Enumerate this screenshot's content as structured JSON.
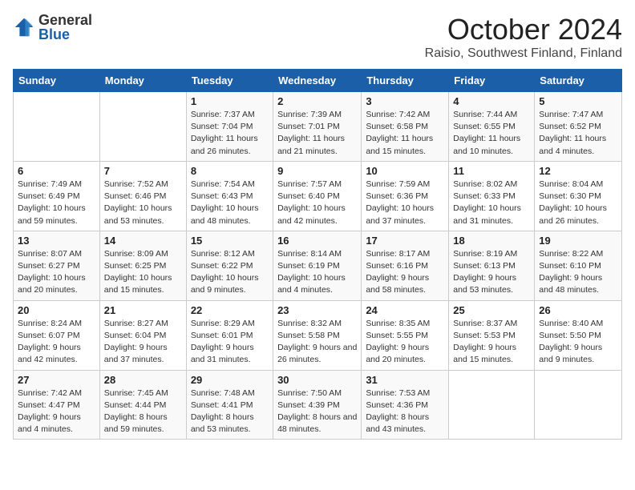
{
  "logo": {
    "general": "General",
    "blue": "Blue"
  },
  "header": {
    "month": "October 2024",
    "location": "Raisio, Southwest Finland, Finland"
  },
  "weekdays": [
    "Sunday",
    "Monday",
    "Tuesday",
    "Wednesday",
    "Thursday",
    "Friday",
    "Saturday"
  ],
  "weeks": [
    [
      {
        "day": "",
        "info": ""
      },
      {
        "day": "",
        "info": ""
      },
      {
        "day": "1",
        "info": "Sunrise: 7:37 AM\nSunset: 7:04 PM\nDaylight: 11 hours and 26 minutes."
      },
      {
        "day": "2",
        "info": "Sunrise: 7:39 AM\nSunset: 7:01 PM\nDaylight: 11 hours and 21 minutes."
      },
      {
        "day": "3",
        "info": "Sunrise: 7:42 AM\nSunset: 6:58 PM\nDaylight: 11 hours and 15 minutes."
      },
      {
        "day": "4",
        "info": "Sunrise: 7:44 AM\nSunset: 6:55 PM\nDaylight: 11 hours and 10 minutes."
      },
      {
        "day": "5",
        "info": "Sunrise: 7:47 AM\nSunset: 6:52 PM\nDaylight: 11 hours and 4 minutes."
      }
    ],
    [
      {
        "day": "6",
        "info": "Sunrise: 7:49 AM\nSunset: 6:49 PM\nDaylight: 10 hours and 59 minutes."
      },
      {
        "day": "7",
        "info": "Sunrise: 7:52 AM\nSunset: 6:46 PM\nDaylight: 10 hours and 53 minutes."
      },
      {
        "day": "8",
        "info": "Sunrise: 7:54 AM\nSunset: 6:43 PM\nDaylight: 10 hours and 48 minutes."
      },
      {
        "day": "9",
        "info": "Sunrise: 7:57 AM\nSunset: 6:40 PM\nDaylight: 10 hours and 42 minutes."
      },
      {
        "day": "10",
        "info": "Sunrise: 7:59 AM\nSunset: 6:36 PM\nDaylight: 10 hours and 37 minutes."
      },
      {
        "day": "11",
        "info": "Sunrise: 8:02 AM\nSunset: 6:33 PM\nDaylight: 10 hours and 31 minutes."
      },
      {
        "day": "12",
        "info": "Sunrise: 8:04 AM\nSunset: 6:30 PM\nDaylight: 10 hours and 26 minutes."
      }
    ],
    [
      {
        "day": "13",
        "info": "Sunrise: 8:07 AM\nSunset: 6:27 PM\nDaylight: 10 hours and 20 minutes."
      },
      {
        "day": "14",
        "info": "Sunrise: 8:09 AM\nSunset: 6:25 PM\nDaylight: 10 hours and 15 minutes."
      },
      {
        "day": "15",
        "info": "Sunrise: 8:12 AM\nSunset: 6:22 PM\nDaylight: 10 hours and 9 minutes."
      },
      {
        "day": "16",
        "info": "Sunrise: 8:14 AM\nSunset: 6:19 PM\nDaylight: 10 hours and 4 minutes."
      },
      {
        "day": "17",
        "info": "Sunrise: 8:17 AM\nSunset: 6:16 PM\nDaylight: 9 hours and 58 minutes."
      },
      {
        "day": "18",
        "info": "Sunrise: 8:19 AM\nSunset: 6:13 PM\nDaylight: 9 hours and 53 minutes."
      },
      {
        "day": "19",
        "info": "Sunrise: 8:22 AM\nSunset: 6:10 PM\nDaylight: 9 hours and 48 minutes."
      }
    ],
    [
      {
        "day": "20",
        "info": "Sunrise: 8:24 AM\nSunset: 6:07 PM\nDaylight: 9 hours and 42 minutes."
      },
      {
        "day": "21",
        "info": "Sunrise: 8:27 AM\nSunset: 6:04 PM\nDaylight: 9 hours and 37 minutes."
      },
      {
        "day": "22",
        "info": "Sunrise: 8:29 AM\nSunset: 6:01 PM\nDaylight: 9 hours and 31 minutes."
      },
      {
        "day": "23",
        "info": "Sunrise: 8:32 AM\nSunset: 5:58 PM\nDaylight: 9 hours and 26 minutes."
      },
      {
        "day": "24",
        "info": "Sunrise: 8:35 AM\nSunset: 5:55 PM\nDaylight: 9 hours and 20 minutes."
      },
      {
        "day": "25",
        "info": "Sunrise: 8:37 AM\nSunset: 5:53 PM\nDaylight: 9 hours and 15 minutes."
      },
      {
        "day": "26",
        "info": "Sunrise: 8:40 AM\nSunset: 5:50 PM\nDaylight: 9 hours and 9 minutes."
      }
    ],
    [
      {
        "day": "27",
        "info": "Sunrise: 7:42 AM\nSunset: 4:47 PM\nDaylight: 9 hours and 4 minutes."
      },
      {
        "day": "28",
        "info": "Sunrise: 7:45 AM\nSunset: 4:44 PM\nDaylight: 8 hours and 59 minutes."
      },
      {
        "day": "29",
        "info": "Sunrise: 7:48 AM\nSunset: 4:41 PM\nDaylight: 8 hours and 53 minutes."
      },
      {
        "day": "30",
        "info": "Sunrise: 7:50 AM\nSunset: 4:39 PM\nDaylight: 8 hours and 48 minutes."
      },
      {
        "day": "31",
        "info": "Sunrise: 7:53 AM\nSunset: 4:36 PM\nDaylight: 8 hours and 43 minutes."
      },
      {
        "day": "",
        "info": ""
      },
      {
        "day": "",
        "info": ""
      }
    ]
  ]
}
